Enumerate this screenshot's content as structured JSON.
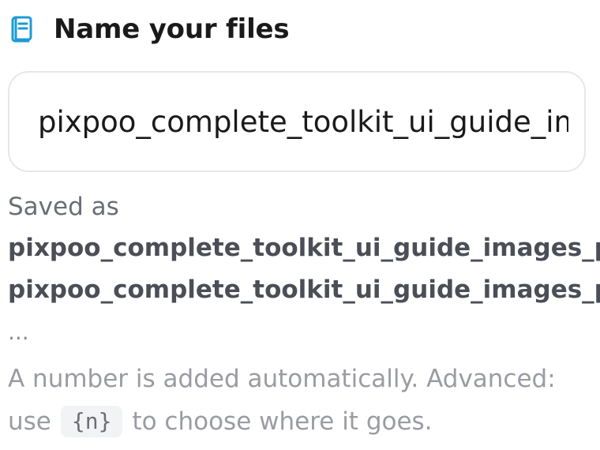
{
  "header": {
    "icon": "document-icon",
    "title": "Name your files"
  },
  "name_input": {
    "value": "pixpoo_complete_toolkit_ui_guide_images_pa"
  },
  "saved": {
    "label": "Saved as",
    "files": [
      "pixpoo_complete_toolkit_ui_guide_images_pa",
      "pixpoo_complete_toolkit_ui_guide_images_pa"
    ],
    "more": "..."
  },
  "help": {
    "line1": "A number is added automatically. Advanced:",
    "line2_prefix": "use",
    "token": "{n}",
    "line2_suffix": "to choose where it goes."
  },
  "colors": {
    "icon_accent": "#1a9bd7",
    "title": "#1a1a1a",
    "muted_text": "#9a9ca2"
  }
}
